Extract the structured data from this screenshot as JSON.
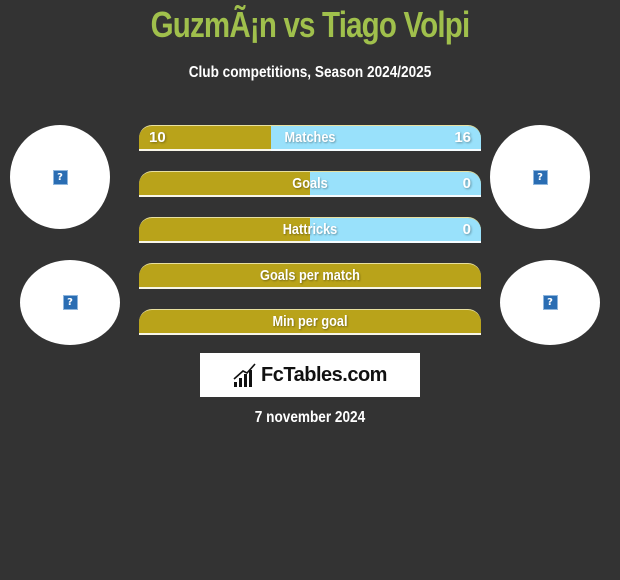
{
  "header": {
    "title": "GuzmÃ¡n vs Tiago Volpi",
    "subtitle": "Club competitions, Season 2024/2025"
  },
  "logos": {
    "left_top_icon": "broken-image-icon",
    "left_bottom_icon": "broken-image-icon",
    "right_top_icon": "broken-image-icon",
    "right_bottom_icon": "broken-image-icon",
    "glyph": "?"
  },
  "colors": {
    "background": "#333333",
    "title": "#a0c04c",
    "left_player": "#b9a31a",
    "right_player": "#99e1fb"
  },
  "stats": [
    {
      "label": "Matches",
      "left": "10",
      "right": "16",
      "left_share": 0.3846
    },
    {
      "label": "Goals",
      "left": "",
      "right": "0",
      "left_share": 0.5
    },
    {
      "label": "Hattricks",
      "left": "",
      "right": "0",
      "left_share": 0.5
    },
    {
      "label": "Goals per match",
      "left": "",
      "right": "",
      "left_share": 1.0
    },
    {
      "label": "Min per goal",
      "left": "",
      "right": "",
      "left_share": 1.0
    }
  ],
  "brand": {
    "icon": "bar-chart-icon",
    "name": "FcTables.com"
  },
  "footer": {
    "date": "7 november 2024"
  }
}
